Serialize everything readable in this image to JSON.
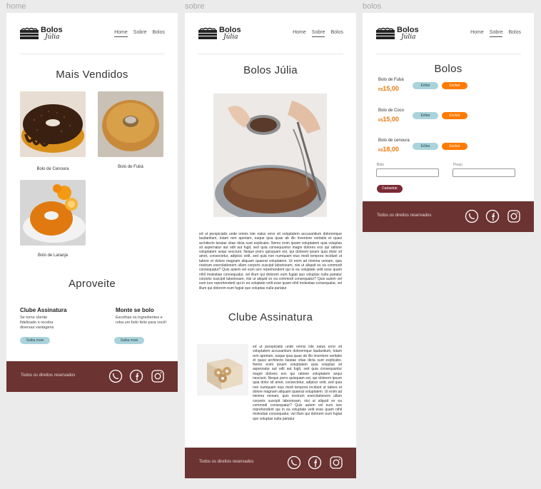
{
  "labels": {
    "home": "home",
    "sobre": "sobre",
    "bolos": "bolos"
  },
  "brand": {
    "name": "Bolos",
    "sub": "Júlia"
  },
  "nav": {
    "home": "Home",
    "sobre": "Sobre",
    "bolos": "Bolos"
  },
  "home": {
    "title": "Mais Vendidos",
    "products": [
      {
        "name": "Bolo de Cenoura"
      },
      {
        "name": "Bolo de Fubá"
      },
      {
        "name": "Bolo de Laranja"
      }
    ],
    "section2": "Aproveite",
    "features": [
      {
        "title": "Clube Assinatura",
        "text": "Se torne cliente fidelizado e receba diversas vantagens",
        "button": "Saiba mais"
      },
      {
        "title": "Monte se bolo",
        "text": "Escolhas os ingredientes e reba um bolo feito para você!",
        "button": "Saiba mais"
      }
    ]
  },
  "sobre": {
    "title": "Bolos Júlia",
    "paragraph": "ed ut perspiciatis unde omnis iste natus error sit voluptatem accusantium doloremque laudantium, totam rem aperiam, eaque ipsa quae ab illo inventore veritatis et quasi architecto beatae vitae dicta sunt explicabo. Nemo enim ipsam voluptatem quia voluptas sit aspernatur aut odit aut fugit, sed quia consequuntur magni dolores eos qui ratione voluptatem sequi nesciunt. Neque porro quisquam est, qui dolorem ipsum quia dolor sit amet, consectetur, adipisci velit, sed quia non numquam eius modi tempora incidunt ut labore et dolore magnam aliquam quaerat voluptatem. Ut enim ad minima veniam, quis nostrum exercitationem ullam corporis suscipit laboriosam, nisi ut aliquid ex ea commodi consequatur? Quis autem vel eum iure reprehenderit qui in ea voluptate velit esse quam nihil molestiae consequatur, vel illum qui dolorem eum fugiat quo voluptas nulla pariatur corporis suscipit laboriosam, nisi ut aliquid ex ea commodi consequatur? Quis autem vel eum iure reprehenderit qui in ea voluptate velit esse quam nihil molestiae consequatur, vel illum qui dolorem eum fugiat quo voluptas nulla pariatur",
    "section2": "Clube Assinatura",
    "club_text": "ed ut perspiciatis unde omnis iste natus error sit voluptatem accusantium doloremque laudantium, totam rem aperiam, eaque ipsa quae ab illo inventore veritatis et quasi architecto beatae vitae dicta sunt explicabo. Nemo enim ipsam voluptatem quia voluptas sit aspernatur aut odit aut fugit, sed quia consequuntur magni dolores eos qui ratione voluptatem sequi nesciunt. Neque porro quisquam est, qui dolorem ipsum quia dolor sit amet, consectetur, adipisci velit, sed quia non numquam eius modi tempora incidunt ut labore et dolore magnam aliquam quaerat voluptatem. Ut enim ad minima veniam, quis nostrum exercitationem ullam corporis suscipit laboriosam, nisi ut aliquid ex ea commodi consequatur? Quis autem vel eum iure reprehenderit qui in ea voluptate velit esse quam nihil molestiae consequatur, vel illum qui dolorem eum fugiat quo voluptas nulla pariatur"
  },
  "bolos": {
    "title": "Bolos",
    "currency": "R$",
    "items": [
      {
        "name": "Bolo de Fubá",
        "price": "15,00"
      },
      {
        "name": "Bolo de Coco",
        "price": "15,00"
      },
      {
        "name": "Bolo de cenoura",
        "price": "18,00"
      }
    ],
    "edit": "Editar",
    "delete": "Excluir",
    "field_bolo": "Bolo",
    "field_preco": "Preço",
    "submit": "Cadastrar"
  },
  "footer": {
    "text": "Todos os direitos reservados"
  },
  "colors": {
    "footer": "#6b3332",
    "accent": "#ff7a00",
    "pill": "#aad3dc",
    "submit": "#7a2a33"
  }
}
